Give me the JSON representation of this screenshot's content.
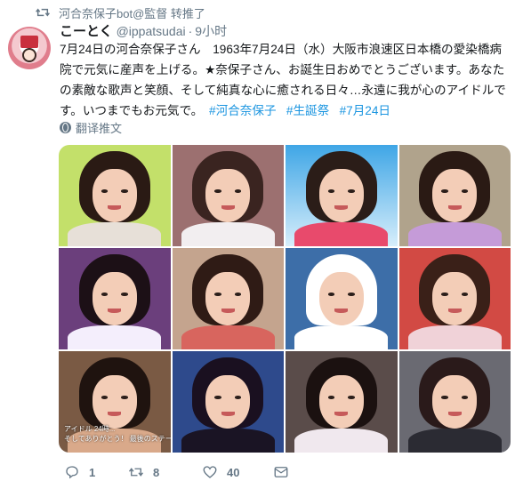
{
  "retweet": {
    "text": "河合奈保子bot@監督 转推了",
    "icon": "retweet-icon"
  },
  "author": {
    "name": "こーとく",
    "handle": "@ippatsudai",
    "separator": "·",
    "time": "9小时"
  },
  "tweet": {
    "body": "7月24日の河合奈保子さん　1963年7月24日（水）大阪市浪速区日本橋の愛染橋病院で元気に産声を上げる。★奈保子さん、お誕生日おめでとうございます。あなたの素敵な歌声と笑顔、そして純真な心に癒される日々…永遠に我が心のアイドルです。いつまでもお元気で。　",
    "hashtags": [
      "#河合奈保子",
      "#生誕祭",
      "#7月24日"
    ]
  },
  "translate": {
    "label": "翻译推文",
    "icon": "globe-icon"
  },
  "media": {
    "overlay_caption_line1": "アイドル 24時...",
    "overlay_caption_line2": "そしてありがとう！ 最後のステージで"
  },
  "actions": {
    "reply": {
      "icon": "reply-icon",
      "count": "1"
    },
    "retweet": {
      "icon": "retweet-icon",
      "count": "8"
    },
    "like": {
      "icon": "heart-icon",
      "count": "40"
    },
    "dm": {
      "icon": "mail-icon"
    }
  },
  "colors": {
    "link": "#1b95e0",
    "secondary_text": "#657786",
    "primary_text": "#14171a"
  }
}
